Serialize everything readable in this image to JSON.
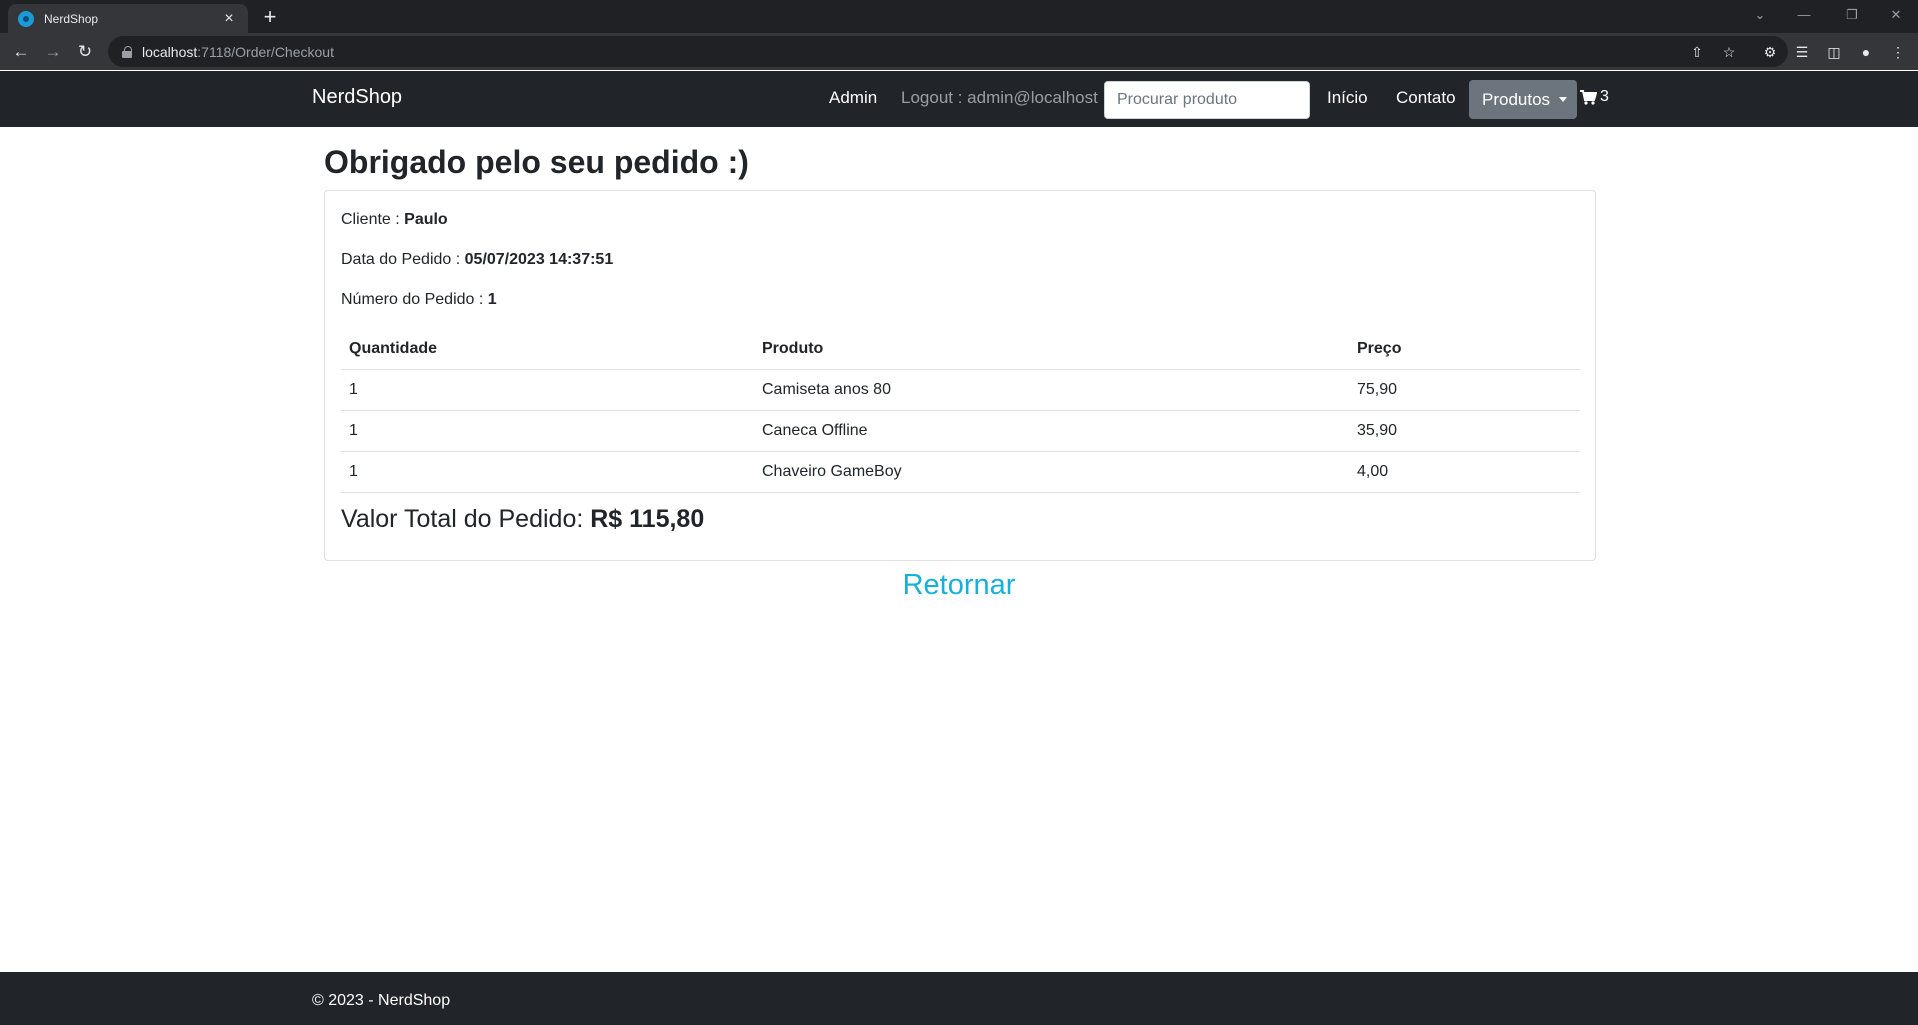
{
  "browser": {
    "tab_title": "NerdShop",
    "tab_close": "×",
    "new_tab": "+",
    "url_host": "localhost",
    "url_path": ":7118/Order/Checkout"
  },
  "navbar": {
    "brand": "NerdShop",
    "admin": "Admin",
    "logout": "Logout : admin@localhost",
    "search_placeholder": "Procurar produto",
    "home": "Início",
    "contact": "Contato",
    "products": "Produtos",
    "cart_count": "3"
  },
  "order": {
    "title": "Obrigado pelo seu pedido :)",
    "client_label": "Cliente : ",
    "client_value": "Paulo",
    "date_label": "Data do Pedido : ",
    "date_value": "05/07/2023 14:37:51",
    "number_label": "Número do Pedido : ",
    "number_value": "1",
    "columns": [
      "Quantidade",
      "Produto",
      "Preço"
    ],
    "items": [
      {
        "qty": "1",
        "product": "Camiseta anos 80",
        "price": "75,90"
      },
      {
        "qty": "1",
        "product": "Caneca Offline",
        "price": "35,90"
      },
      {
        "qty": "1",
        "product": "Chaveiro GameBoy",
        "price": "4,00"
      }
    ],
    "total_label": "Valor Total do Pedido: ",
    "total_value": "R$ 115,80",
    "return_link": "Retornar"
  },
  "footer": {
    "text": "© 2023 - NerdShop"
  },
  "colors": {
    "navbar_bg": "#212529",
    "dropdown_bg": "#6c757d",
    "link": "#17b0da"
  }
}
